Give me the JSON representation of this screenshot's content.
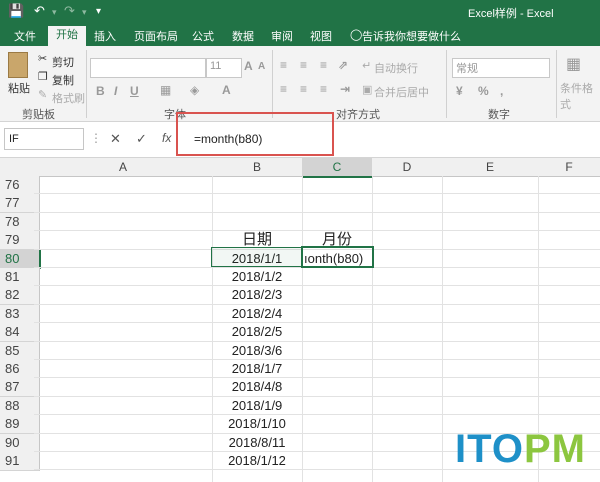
{
  "window": {
    "title": "Excel样例 - Excel"
  },
  "quick_access": {
    "save_icon": "save-icon",
    "undo_icon": "undo-icon",
    "redo_icon": "redo-icon",
    "customize_icon": "customize-qat-icon"
  },
  "tabs": [
    "文件",
    "开始",
    "插入",
    "页面布局",
    "公式",
    "数据",
    "审阅",
    "视图"
  ],
  "active_tab": "开始",
  "tell_me": "告诉我你想要做什么",
  "ribbon": {
    "clipboard": {
      "paste": "粘贴",
      "cut": "剪切",
      "copy": "复制",
      "format_painter": "格式刷",
      "group": "剪贴板"
    },
    "font": {
      "size": "11",
      "group": "字体",
      "bold": "B",
      "italic": "I",
      "underline": "U"
    },
    "alignment": {
      "wrap_text": "自动换行",
      "merge_center": "合并后居中",
      "group": "对齐方式"
    },
    "number": {
      "format": "常规",
      "group": "数字"
    },
    "styles": {
      "conditional": "条件格式"
    }
  },
  "formula_bar": {
    "name_box": "IF",
    "cancel": "✕",
    "enter": "✓",
    "fx": "fx",
    "formula": "=month(b80)"
  },
  "grid": {
    "columns": [
      "A",
      "B",
      "C",
      "D",
      "E",
      "F"
    ],
    "selected_column": "C",
    "rows": [
      {
        "num": "76",
        "b": "",
        "c": ""
      },
      {
        "num": "77",
        "b": "",
        "c": ""
      },
      {
        "num": "78",
        "b": "",
        "c": ""
      },
      {
        "num": "79",
        "b": "日期",
        "c": "月份"
      },
      {
        "num": "80",
        "b": "2018/1/1",
        "c": "ıonth(b80)"
      },
      {
        "num": "81",
        "b": "2018/1/2",
        "c": ""
      },
      {
        "num": "82",
        "b": "2018/2/3",
        "c": ""
      },
      {
        "num": "83",
        "b": "2018/2/4",
        "c": ""
      },
      {
        "num": "84",
        "b": "2018/2/5",
        "c": ""
      },
      {
        "num": "85",
        "b": "2018/3/6",
        "c": ""
      },
      {
        "num": "86",
        "b": "2018/1/7",
        "c": ""
      },
      {
        "num": "87",
        "b": "2018/4/8",
        "c": ""
      },
      {
        "num": "88",
        "b": "2018/1/9",
        "c": ""
      },
      {
        "num": "89",
        "b": "2018/1/10",
        "c": ""
      },
      {
        "num": "90",
        "b": "2018/8/11",
        "c": ""
      },
      {
        "num": "91",
        "b": "2018/1/12",
        "c": ""
      }
    ],
    "selected_row": "80"
  },
  "watermark": {
    "text": "ITOPM"
  },
  "colors": {
    "excel_green": "#217346",
    "highlight_red": "#d9534f",
    "logo_blue": "#1e90c8",
    "logo_green": "#8cc63f"
  }
}
